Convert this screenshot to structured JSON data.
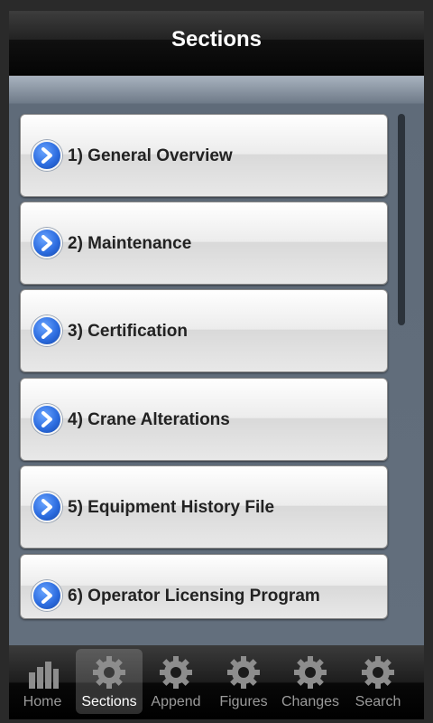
{
  "header": {
    "title": "Sections"
  },
  "sections": [
    {
      "label": "1) General Overview"
    },
    {
      "label": "2) Maintenance"
    },
    {
      "label": "3) Certification"
    },
    {
      "label": "4) Crane Alterations"
    },
    {
      "label": "5) Equipment History File"
    },
    {
      "label": "6) Operator Licensing Program"
    }
  ],
  "tabs": [
    {
      "label": "Home",
      "icon": "bar-chart-icon",
      "active": false
    },
    {
      "label": "Sections",
      "icon": "gear-icon",
      "active": true
    },
    {
      "label": "Append",
      "icon": "gear-icon",
      "active": false
    },
    {
      "label": "Figures",
      "icon": "gear-icon",
      "active": false
    },
    {
      "label": "Changes",
      "icon": "gear-icon",
      "active": false
    },
    {
      "label": "Search",
      "icon": "gear-icon",
      "active": false
    }
  ],
  "colors": {
    "accent": "#2d6de0",
    "background": "#636f7d"
  }
}
